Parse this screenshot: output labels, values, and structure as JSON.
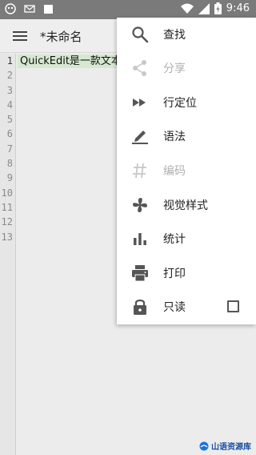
{
  "status_bar": {
    "time": "9:46"
  },
  "toolbar": {
    "title": "*未命名"
  },
  "editor": {
    "line_numbers": [
      "1",
      "2",
      "3",
      "4",
      "5",
      "6",
      "7",
      "8",
      "9",
      "10",
      "11",
      "12",
      "13"
    ],
    "line1_text": "QuickEdit是一款文本"
  },
  "menu": {
    "items": [
      {
        "label": "查找",
        "icon": "search-icon",
        "enabled": true
      },
      {
        "label": "分享",
        "icon": "share-icon",
        "enabled": false
      },
      {
        "label": "行定位",
        "icon": "fast-forward-icon",
        "enabled": true
      },
      {
        "label": "语法",
        "icon": "pen-underline-icon",
        "enabled": true
      },
      {
        "label": "编码",
        "icon": "hash-icon",
        "enabled": false
      },
      {
        "label": "视觉样式",
        "icon": "fan-icon",
        "enabled": true
      },
      {
        "label": "统计",
        "icon": "bar-chart-icon",
        "enabled": true
      },
      {
        "label": "打印",
        "icon": "printer-icon",
        "enabled": true
      },
      {
        "label": "只读",
        "icon": "lock-icon",
        "enabled": true,
        "checked": false
      }
    ]
  },
  "watermark": {
    "text": "山语资源库"
  },
  "colors": {
    "status_bar": "#7a7a7a",
    "line_highlight": "#d5e8d0",
    "icon": "#555555",
    "icon_disabled": "#c8c8c8"
  }
}
